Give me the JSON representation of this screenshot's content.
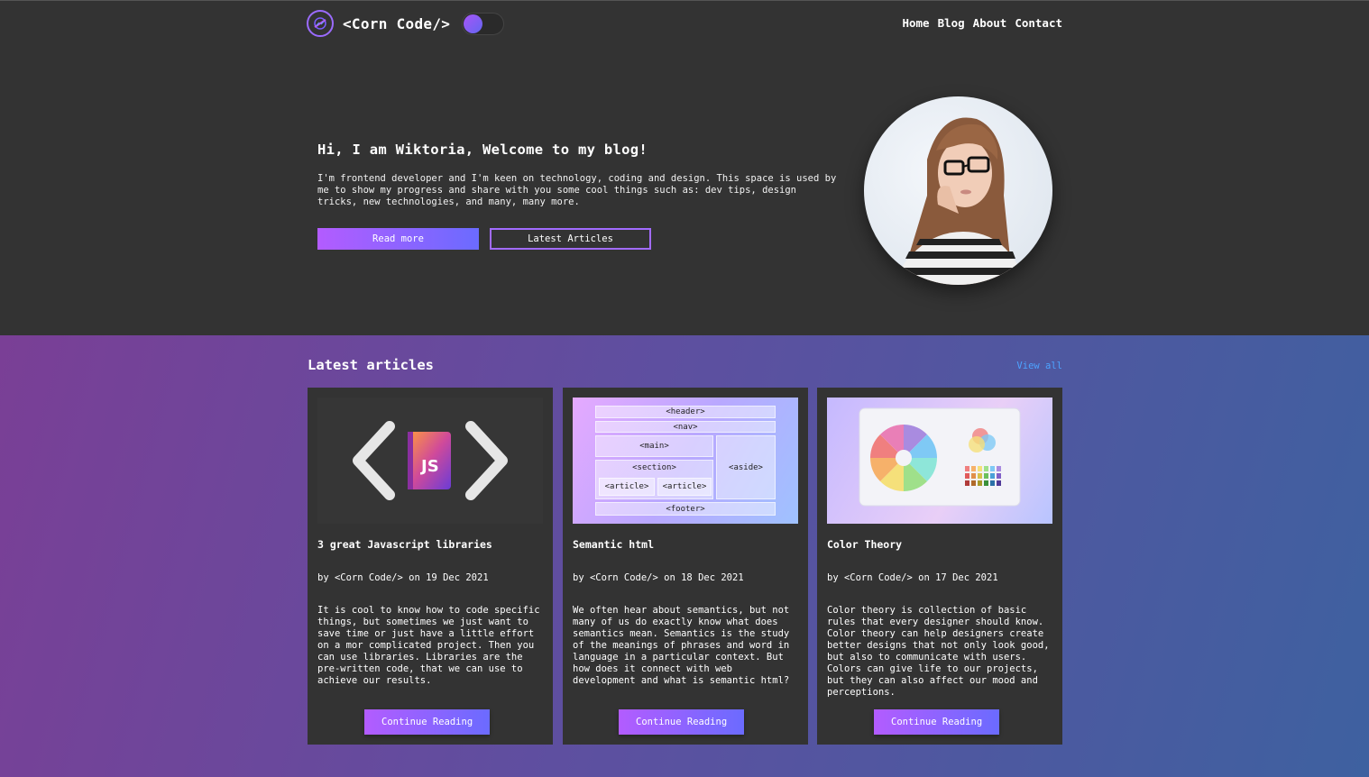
{
  "header": {
    "logo_text": "<Corn Code/>",
    "nav": [
      "Home",
      "Blog",
      "About",
      "Contact"
    ]
  },
  "hero": {
    "title": "Hi, I am Wiktoria, Welcome to my blog!",
    "text": "I'm frontend developer and I'm keen on technology, coding and design. This space is used by me to show my progress and share with you some cool things such as: dev tips, design tricks, new technologies, and many, many more.",
    "read_more": "Read more",
    "latest_articles": "Latest Articles"
  },
  "articles": {
    "title": "Latest articles",
    "view_all": "View all",
    "items": [
      {
        "title": "3 great Javascript libraries",
        "meta": "by <Corn Code/> on 19 Dec 2021",
        "text": "It is cool to know how to code specific things, but sometimes we just want to save time or just have a little effort on a mor complicated project. Then you can use libraries. Libraries are the pre-written code, that we can use to achieve our results.",
        "button": "Continue Reading",
        "image_text": "JS"
      },
      {
        "title": "Semantic html",
        "meta": "by <Corn Code/> on 18 Dec 2021",
        "text": "We often hear about semantics, but not many of us do exactly know what does semantics mean. Semantics is the study of the meanings of phrases and word in language in a particular context. But how does it connect with web development and what is semantic html?",
        "button": "Continue Reading",
        "image_tags": {
          "header": "<header>",
          "nav": "<nav>",
          "main": "<main>",
          "aside": "<aside>",
          "section": "<section>",
          "article1": "<article>",
          "article2": "<article>",
          "footer": "<footer>"
        }
      },
      {
        "title": "Color Theory",
        "meta": "by <Corn Code/> on 17 Dec 2021",
        "text": "Color theory is collection of basic rules that every designer should know. Color theory can help designers create better designs that not only look good, but also to communicate with users. Colors can give life to our projects, but they can also affect our mood and perceptions.",
        "button": "Continue Reading"
      }
    ]
  },
  "colors": {
    "accent_purple": "#b35cff",
    "accent_blue": "#6b6bff",
    "link_blue": "#4da3ff",
    "bg_dark": "#333333"
  },
  "icons": [
    "logo-icon",
    "theme-toggle"
  ]
}
